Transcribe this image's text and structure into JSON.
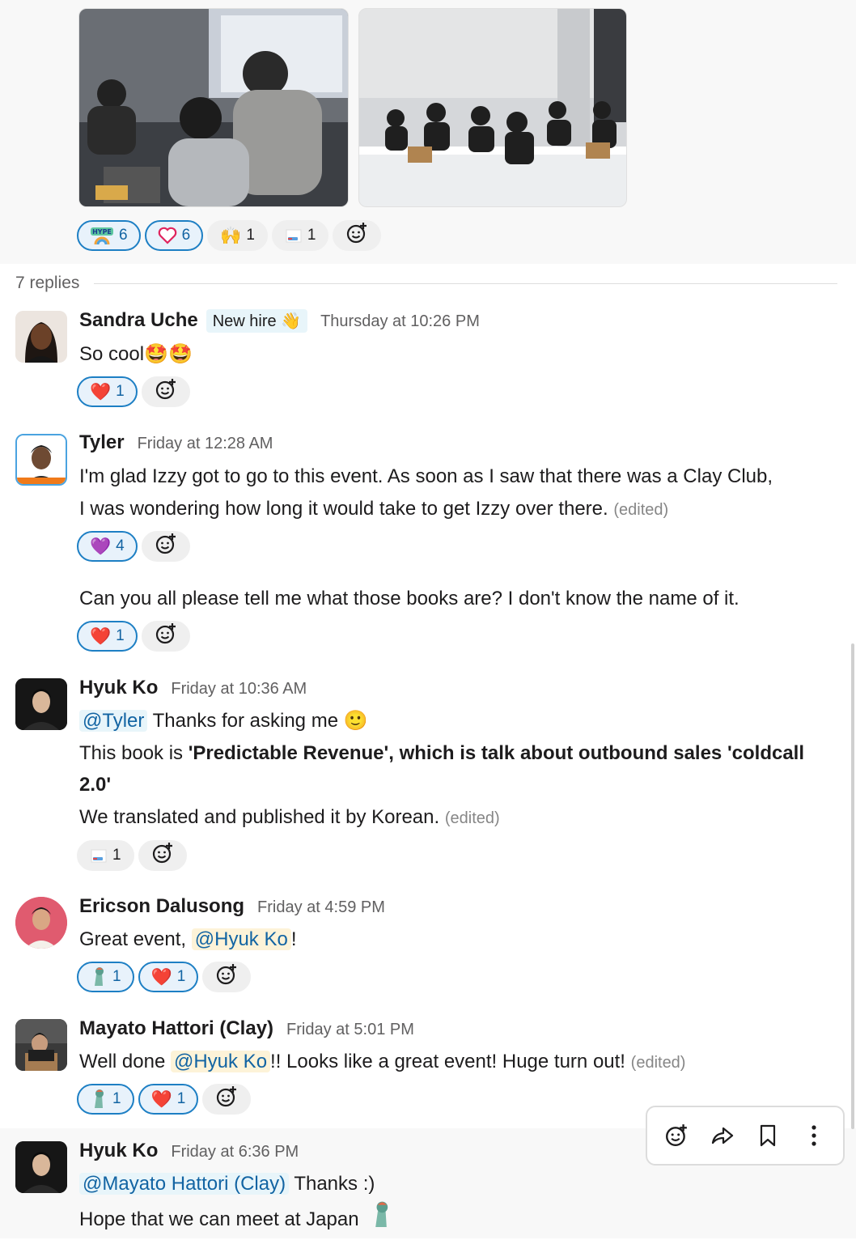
{
  "top_reactions": [
    {
      "icon": "hype-rainbow-icon",
      "label": "HYPE",
      "count": "6",
      "active": true
    },
    {
      "icon": "heart-outline-icon",
      "count": "6",
      "active": true
    },
    {
      "icon": "raised-hands-icon",
      "count": "1",
      "active": false
    },
    {
      "icon": "book-icon",
      "count": "1",
      "active": false
    }
  ],
  "thread": {
    "replies_label": "7 replies"
  },
  "messages": [
    {
      "author": "Sandra Uche",
      "badge": "New hire 👋",
      "time": "Thursday at 10:26 PM",
      "text": "So cool",
      "emoji": "🤩🤩",
      "reactions": [
        {
          "emoji": "❤️",
          "count": "1"
        }
      ]
    },
    {
      "author": "Tyler",
      "time": "Friday at 12:28 AM",
      "line1": "I'm glad Izzy got to go to this event. As soon as I saw that there was a Clay Club,",
      "line2": "I was wondering how long it would take to get Izzy over there.",
      "edited": "(edited)",
      "reactions": [
        {
          "emoji": "💜",
          "count": "4"
        }
      ],
      "followup": "Can you all please tell me what those books are? I don't know the name of it.",
      "followup_reactions": [
        {
          "emoji": "❤️",
          "count": "1"
        }
      ]
    },
    {
      "author": "Hyuk Ko",
      "time": "Friday at 10:36 AM",
      "mention": "@Tyler",
      "line1_rest": " Thanks for asking me ",
      "line1_emoji": "🙂",
      "line2_pre": "This book is ",
      "line2_bold": "'Predictable Revenue', which is talk about outbound sales 'coldcall",
      "line3_bold": "2.0'",
      "line4": "We translated and  published it by Korean.",
      "edited": "(edited)",
      "reactions": [
        {
          "emoji": "📘",
          "count": "1"
        }
      ]
    },
    {
      "author": "Ericson Dalusong",
      "time": "Friday at 4:59 PM",
      "pre": "Great event, ",
      "mention": "@Hyuk Ko",
      "post": "!",
      "reactions": [
        {
          "emoji": "clay-mascot",
          "count": "1"
        },
        {
          "emoji": "❤️",
          "count": "1"
        }
      ]
    },
    {
      "author": "Mayato Hattori (Clay)",
      "time": "Friday at 5:01 PM",
      "pre": "Well done ",
      "mention": "@Hyuk Ko",
      "post": "!! Looks like a great event! Huge turn out!",
      "edited": "(edited)",
      "reactions": [
        {
          "emoji": "clay-mascot",
          "count": "1"
        },
        {
          "emoji": "❤️",
          "count": "1"
        }
      ]
    },
    {
      "author": "Hyuk Ko",
      "time": "Friday at 6:36 PM",
      "mention": "@Mayato Hattori (Clay)",
      "post": " Thanks :)",
      "line2": "Hope that we can meet at Japan"
    }
  ],
  "hover_actions": [
    "add-reaction-icon",
    "share-icon",
    "bookmark-icon",
    "more-icon"
  ]
}
